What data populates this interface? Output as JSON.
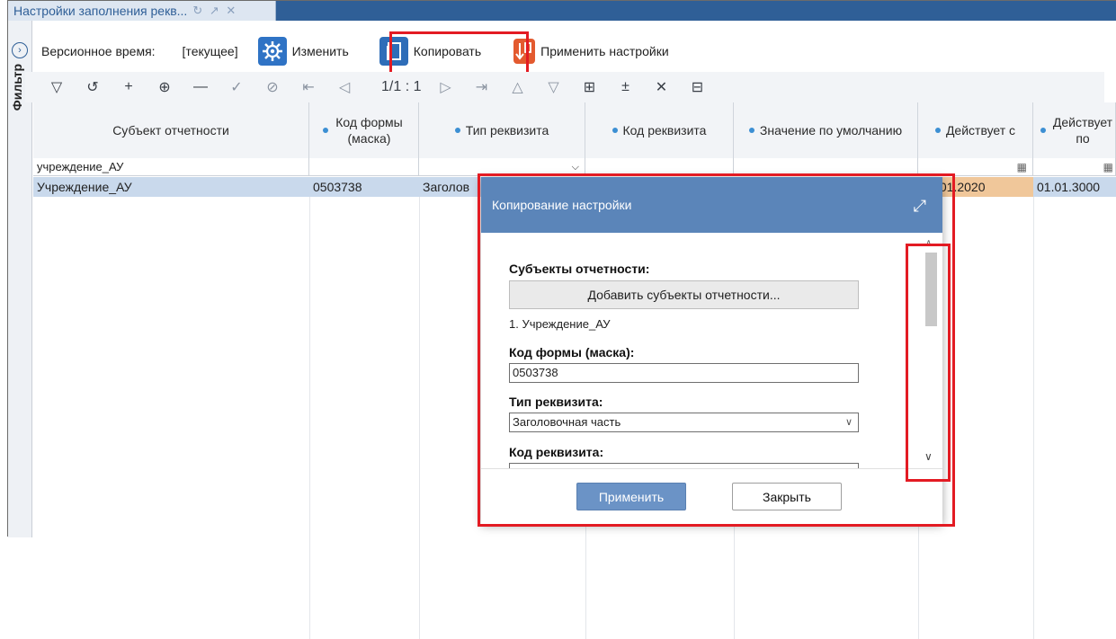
{
  "tab": {
    "title": "Настройки заполнения рекв...",
    "icons": "↻ ↗ ✕"
  },
  "sidebar": {
    "label": "Фильтр",
    "expand_glyph": "›"
  },
  "toolbar": {
    "version_label": "Версионное время:",
    "version_value": "[текущее]",
    "edit_label": "Изменить",
    "copy_label": "Копировать",
    "apply_label": "Применить настройки"
  },
  "nav": {
    "pager": "1/1 : 1"
  },
  "table": {
    "columns": [
      "Субъект отчетности",
      "Код формы (маска)",
      "Тип реквизита",
      "Код реквизита",
      "Значение по умолчанию",
      "Действует с",
      "Действует по"
    ],
    "filter_row": {
      "subject": "учреждение_АУ"
    },
    "row": {
      "subject": "Учреждение_АУ",
      "form_code": "0503738",
      "type": "Заголов",
      "from": ".01.2020",
      "to": "01.01.3000"
    }
  },
  "modal": {
    "title": "Копирование настройки",
    "subjects_label": "Субъекты отчетности:",
    "add_subjects_button": "Добавить субъекты отчетности...",
    "subject_item": "1. Учреждение_АУ",
    "form_code_label": "Код формы (маска):",
    "form_code_value": "0503738",
    "type_label": "Тип реквизита:",
    "type_value": "Заголовочная часть",
    "code_label": "Код реквизита:",
    "apply_button": "Применить",
    "close_button": "Закрыть"
  },
  "colors": {
    "header_blue": "#2f5f97",
    "modal_header": "#5b85b9",
    "highlight_red": "#e31b23",
    "row_selected": "#c9d9ec"
  }
}
